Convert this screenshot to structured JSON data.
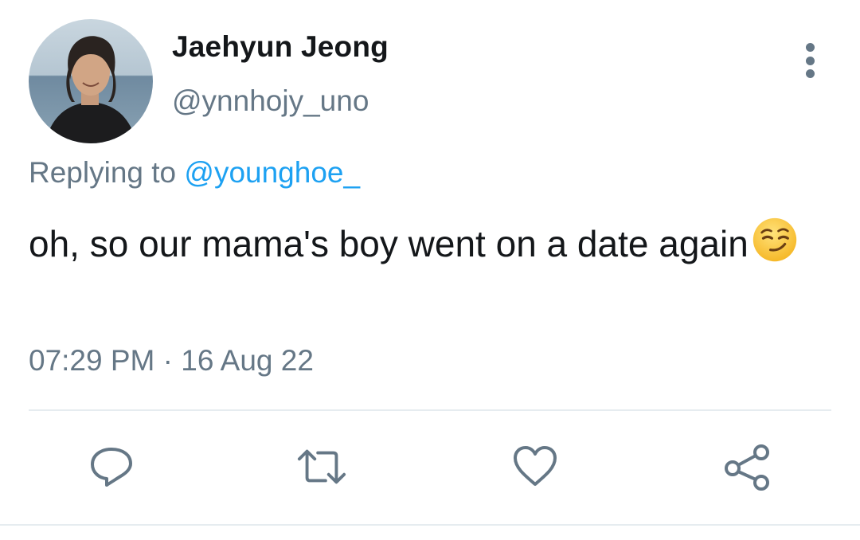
{
  "author": {
    "display_name": "Jaehyun Jeong",
    "handle": "@ynnhojy_uno",
    "avatar": "profile-photo"
  },
  "reply": {
    "prefix": "Replying to",
    "mention": "@younghoe_"
  },
  "tweet": {
    "text": "oh, so our mama's boy went on a date again",
    "emoji": "smirking-face"
  },
  "meta": {
    "time": "07:29 PM",
    "separator": "·",
    "date": "16 Aug 22"
  },
  "actions": [
    {
      "icon": "reply-icon"
    },
    {
      "icon": "retweet-icon"
    },
    {
      "icon": "like-icon"
    },
    {
      "icon": "share-icon"
    }
  ],
  "colors": {
    "text": "#14171a",
    "secondary": "#657786",
    "link": "#1da1f2",
    "divider": "#e6ecf0"
  }
}
